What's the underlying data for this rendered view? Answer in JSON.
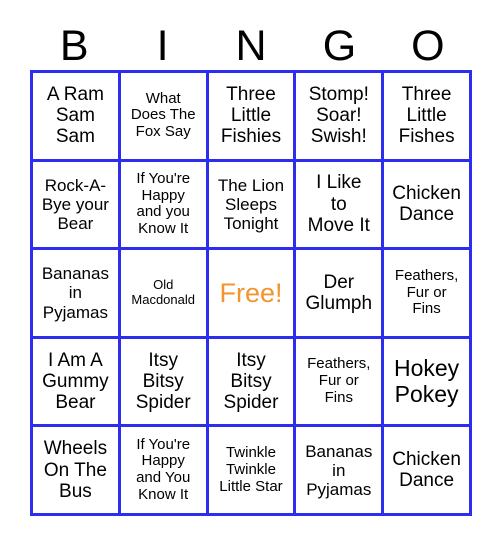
{
  "card": {
    "header_letters": [
      "B",
      "I",
      "N",
      "G",
      "O"
    ],
    "accent_color": "#2d2df0",
    "free_color": "#f2952f",
    "text_color": "#000000",
    "background_color": "#ffffff",
    "rows": [
      [
        {
          "text": "A Ram\nSam\nSam",
          "size": "s-lg",
          "free": false
        },
        {
          "text": "What\nDoes The\nFox Say",
          "size": "s-sm",
          "free": false
        },
        {
          "text": "Three\nLittle\nFishies",
          "size": "s-lg",
          "free": false
        },
        {
          "text": "Stomp!\nSoar!\nSwish!",
          "size": "s-lg",
          "free": false
        },
        {
          "text": "Three\nLittle\nFishes",
          "size": "s-lg",
          "free": false
        }
      ],
      [
        {
          "text": "Rock-A-\nBye your\nBear",
          "size": "s-md",
          "free": false
        },
        {
          "text": "If You're\nHappy\nand you\nKnow It",
          "size": "s-sm",
          "free": false
        },
        {
          "text": "The Lion\nSleeps\nTonight",
          "size": "s-md",
          "free": false
        },
        {
          "text": "I Like\nto\nMove It",
          "size": "s-lg",
          "free": false
        },
        {
          "text": "Chicken\nDance",
          "size": "s-lg",
          "free": false
        }
      ],
      [
        {
          "text": "Bananas\nin\nPyjamas",
          "size": "s-md",
          "free": false
        },
        {
          "text": "Old\nMacdonald",
          "size": "s-xs",
          "free": false
        },
        {
          "text": "Free!",
          "size": "free",
          "free": true
        },
        {
          "text": "Der\nGlumph",
          "size": "s-lg",
          "free": false
        },
        {
          "text": "Feathers,\nFur or\nFins",
          "size": "s-sm",
          "free": false
        }
      ],
      [
        {
          "text": "I Am A\nGummy\nBear",
          "size": "s-lg",
          "free": false
        },
        {
          "text": "Itsy\nBitsy\nSpider",
          "size": "s-lg",
          "free": false
        },
        {
          "text": "Itsy\nBitsy\nSpider",
          "size": "s-lg",
          "free": false
        },
        {
          "text": "Feathers,\nFur or\nFins",
          "size": "s-sm",
          "free": false
        },
        {
          "text": "Hokey\nPokey",
          "size": "s-xl",
          "free": false
        }
      ],
      [
        {
          "text": "Wheels\nOn The\nBus",
          "size": "s-lg",
          "free": false
        },
        {
          "text": "If You're\nHappy\nand You\nKnow It",
          "size": "s-sm",
          "free": false
        },
        {
          "text": "Twinkle\nTwinkle\nLittle Star",
          "size": "s-sm",
          "free": false
        },
        {
          "text": "Bananas\nin\nPyjamas",
          "size": "s-md",
          "free": false
        },
        {
          "text": "Chicken\nDance",
          "size": "s-lg",
          "free": false
        }
      ]
    ]
  }
}
